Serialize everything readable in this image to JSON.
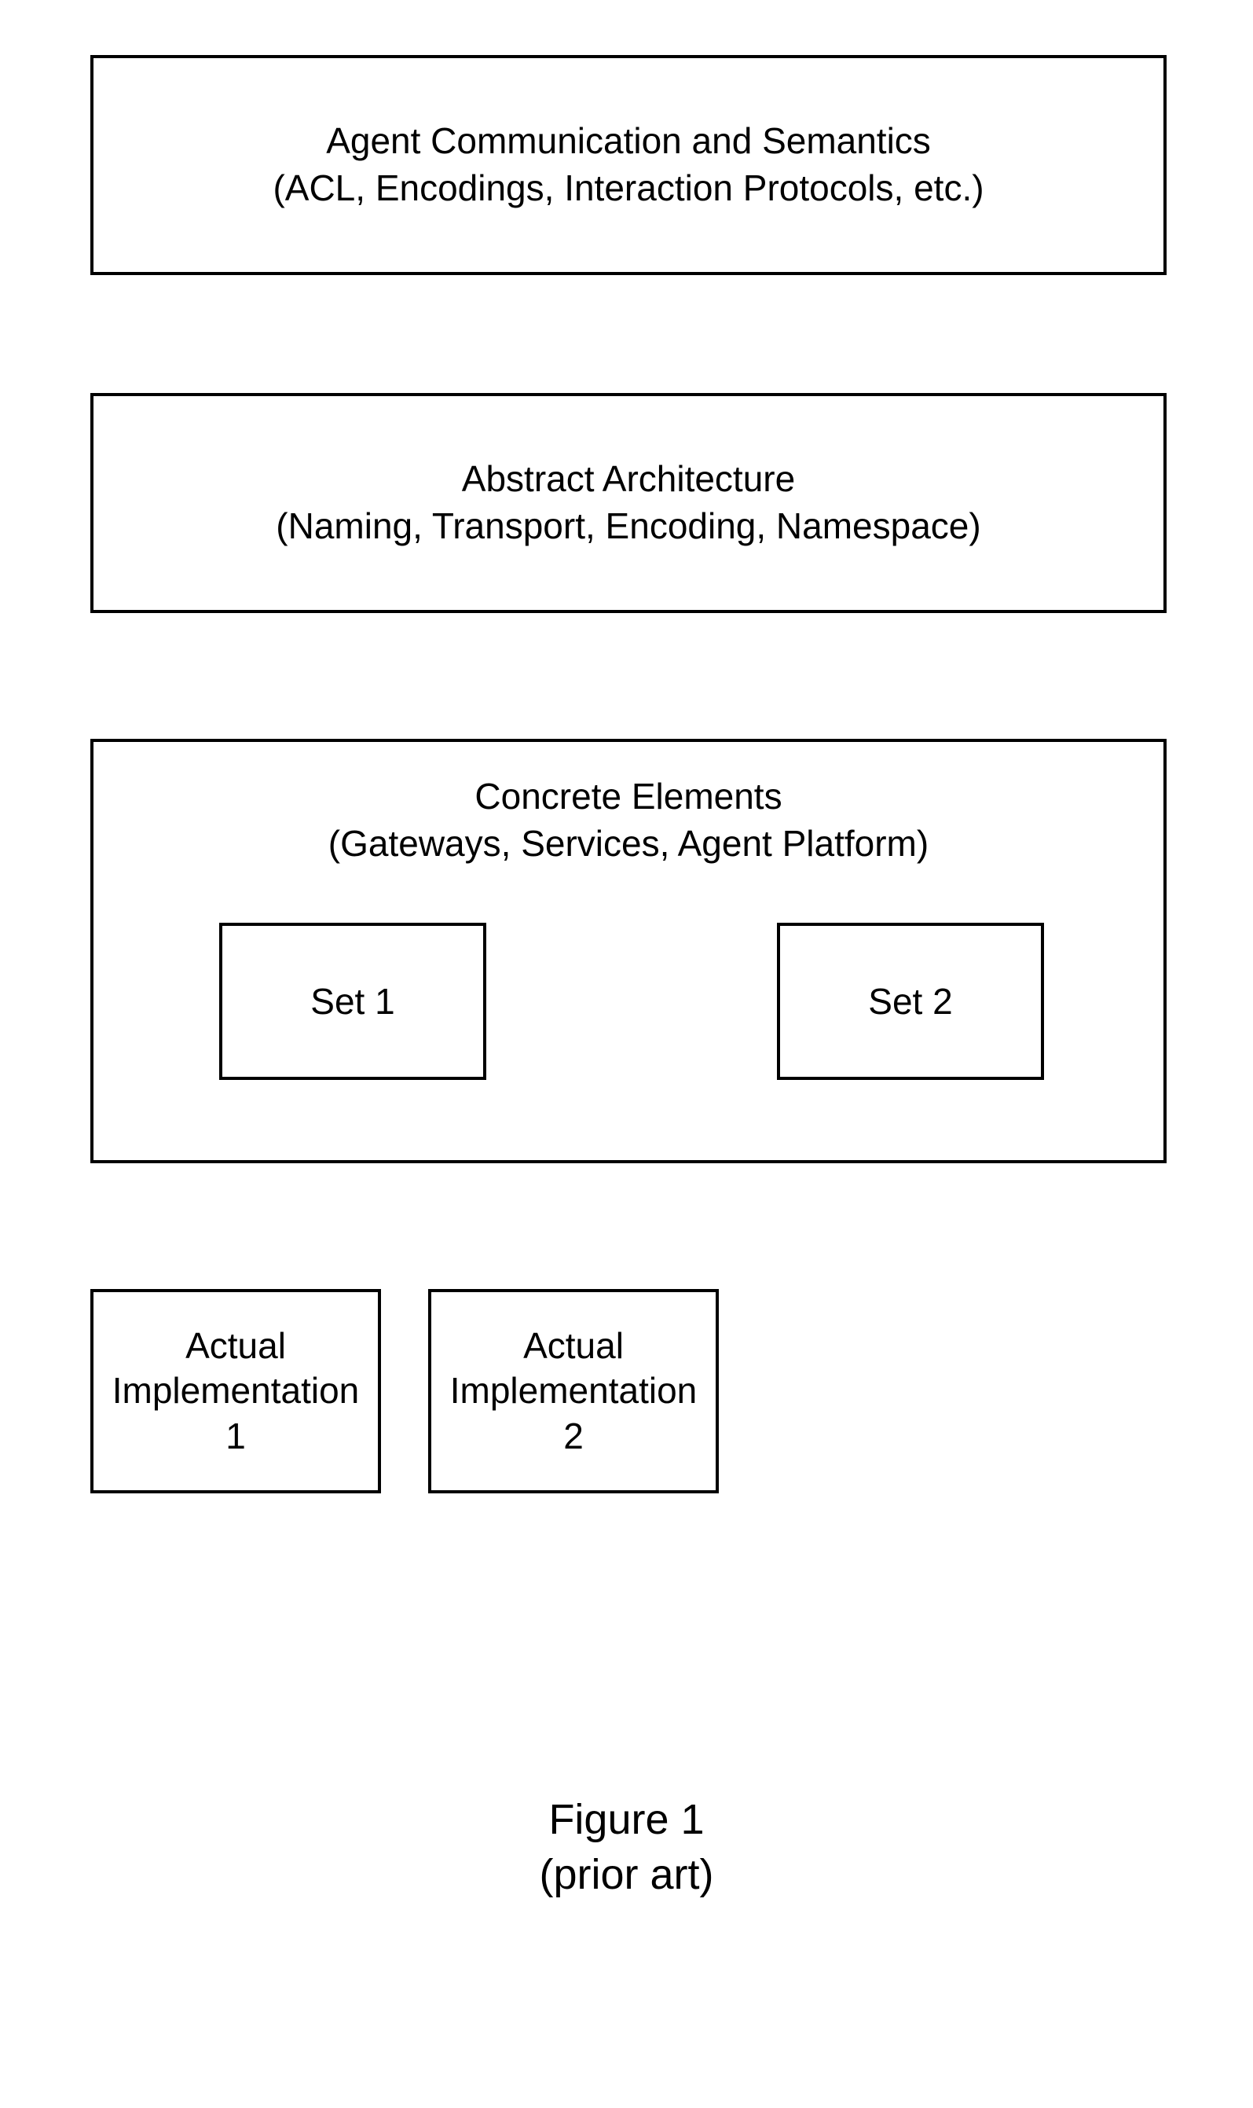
{
  "boxes": {
    "layer1": {
      "title": "Agent Communication and Semantics",
      "subtitle": "(ACL, Encodings, Interaction Protocols, etc.)"
    },
    "layer2": {
      "title": "Abstract Architecture",
      "subtitle": "(Naming, Transport, Encoding, Namespace)"
    },
    "layer3": {
      "title": "Concrete Elements",
      "subtitle": "(Gateways, Services, Agent Platform)",
      "sets": {
        "set1": "Set 1",
        "set2": "Set 2"
      }
    },
    "implementations": {
      "impl1": {
        "line1": "Actual",
        "line2": "Implementation",
        "line3": "1"
      },
      "impl2": {
        "line1": "Actual",
        "line2": "Implementation",
        "line3": "2"
      }
    }
  },
  "caption": {
    "line1": "Figure 1",
    "line2": "(prior art)"
  }
}
